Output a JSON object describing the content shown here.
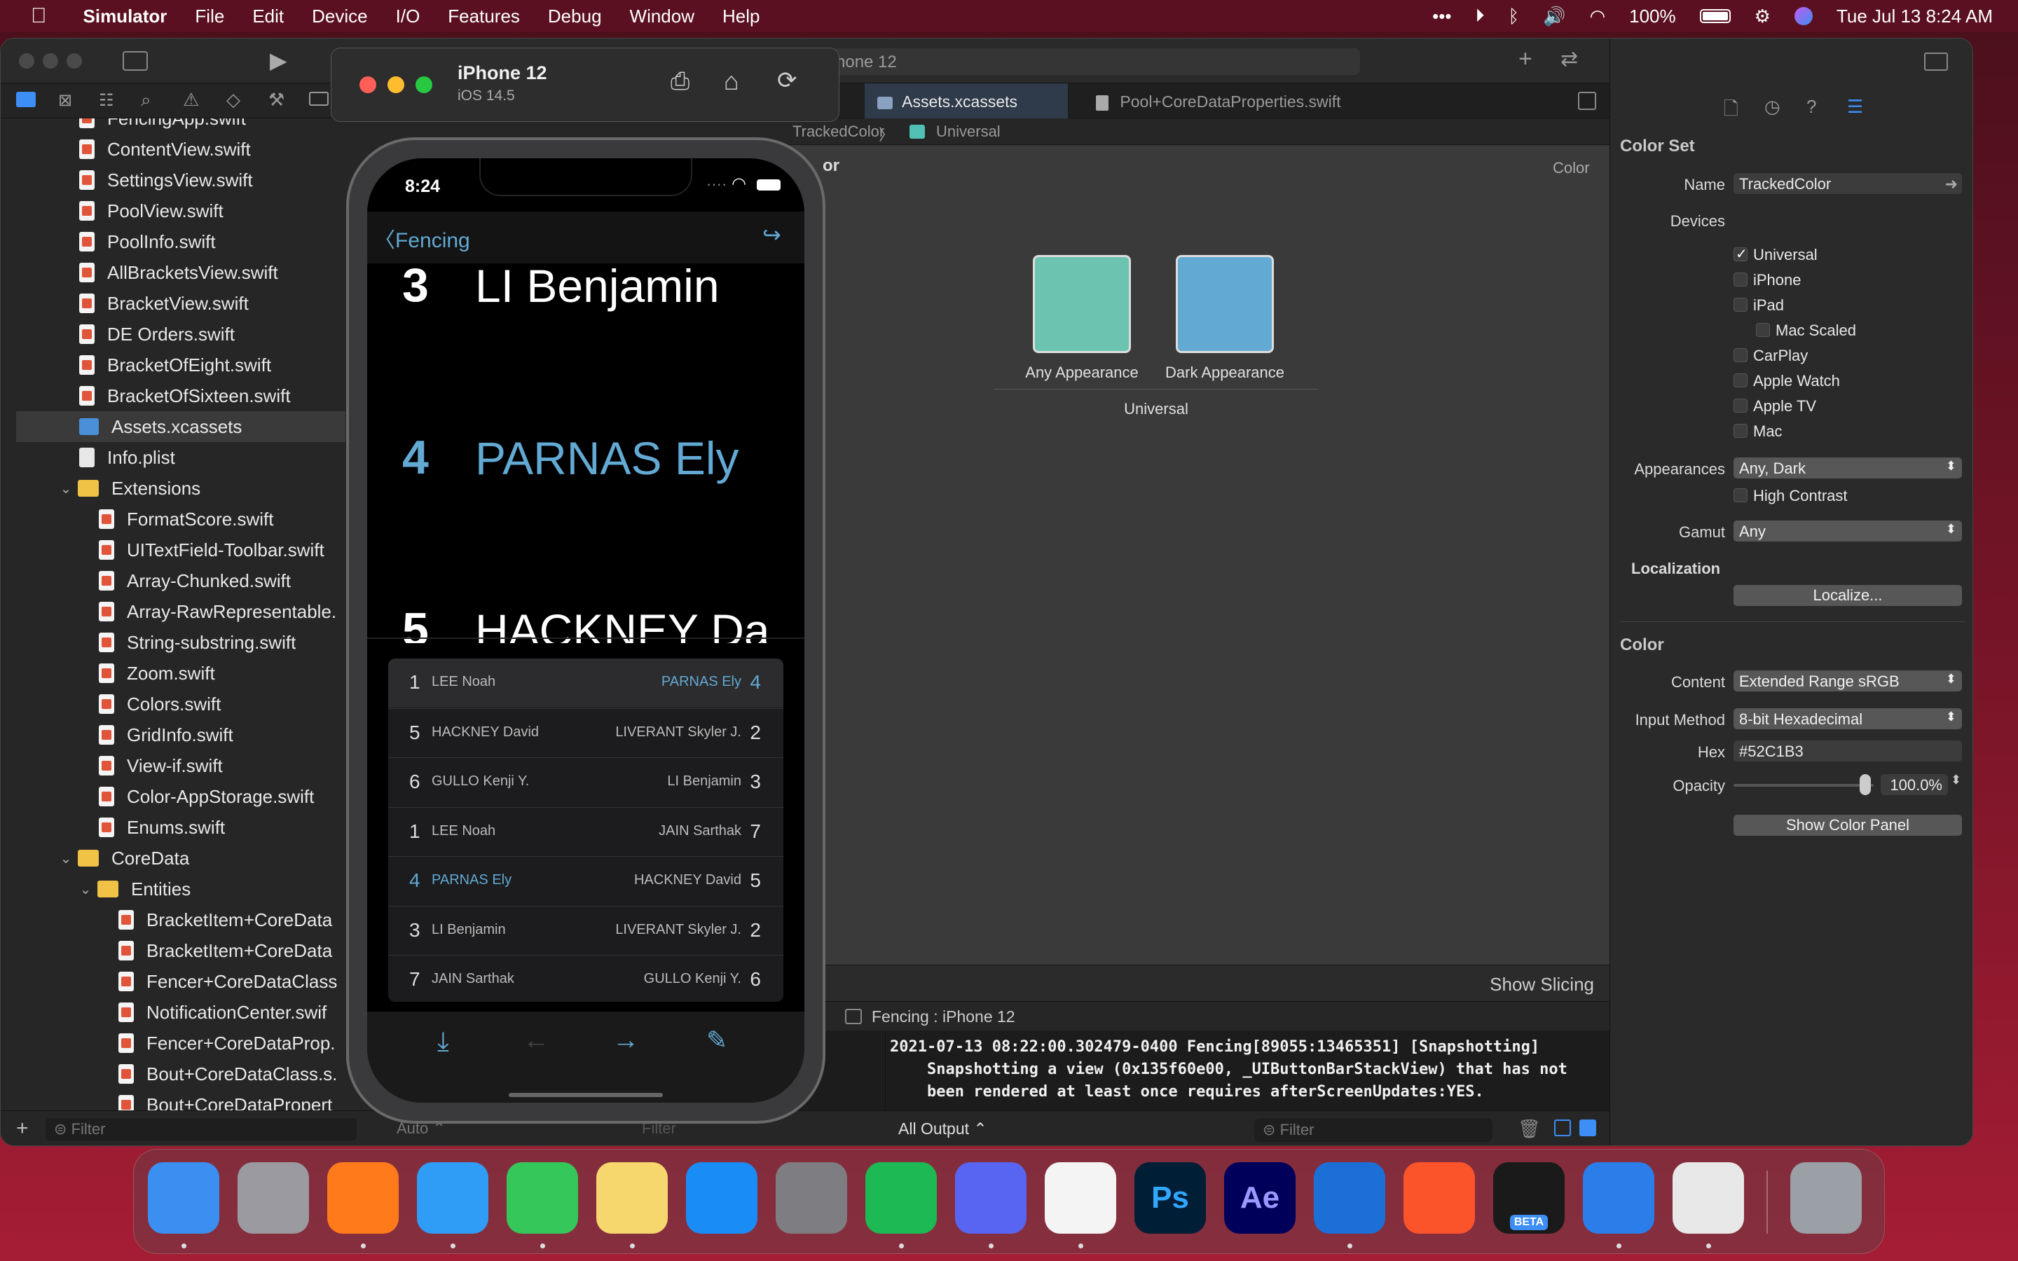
{
  "menubar": {
    "app": "Simulator",
    "items": [
      "File",
      "Edit",
      "Device",
      "I/O",
      "Features",
      "Debug",
      "Window",
      "Help"
    ],
    "battery": "100%",
    "datetime": "Tue Jul 13  8:24 AM"
  },
  "xcode": {
    "scheme_partial": "hone 12",
    "tabs": [
      "Assets.xcassets",
      "Pool+CoreDataProperties.swift"
    ],
    "jumpbar": [
      "TrackedColor",
      "Universal"
    ],
    "navigator_filter_placeholder": "Filter",
    "files": [
      {
        "name": "FencingApp.swift",
        "type": "swift",
        "indent": 0
      },
      {
        "name": "ContentView.swift",
        "type": "swift",
        "indent": 0
      },
      {
        "name": "SettingsView.swift",
        "type": "swift",
        "indent": 0
      },
      {
        "name": "PoolView.swift",
        "type": "swift",
        "indent": 0
      },
      {
        "name": "PoolInfo.swift",
        "type": "swift",
        "indent": 0
      },
      {
        "name": "AllBracketsView.swift",
        "type": "swift",
        "indent": 0
      },
      {
        "name": "BracketView.swift",
        "type": "swift",
        "indent": 0
      },
      {
        "name": "DE Orders.swift",
        "type": "swift",
        "indent": 0
      },
      {
        "name": "BracketOfEight.swift",
        "type": "swift",
        "indent": 0
      },
      {
        "name": "BracketOfSixteen.swift",
        "type": "swift",
        "indent": 0
      },
      {
        "name": "Assets.xcassets",
        "type": "assets",
        "indent": 0,
        "selected": true
      },
      {
        "name": "Info.plist",
        "type": "plist",
        "indent": 0
      },
      {
        "name": "Extensions",
        "type": "folder",
        "indent": 0,
        "open": true
      },
      {
        "name": "FormatScore.swift",
        "type": "swift",
        "indent": 1
      },
      {
        "name": "UITextField-Toolbar.swift",
        "type": "swift",
        "indent": 1
      },
      {
        "name": "Array-Chunked.swift",
        "type": "swift",
        "indent": 1
      },
      {
        "name": "Array-RawRepresentable.",
        "type": "swift",
        "indent": 1
      },
      {
        "name": "String-substring.swift",
        "type": "swift",
        "indent": 1
      },
      {
        "name": "Zoom.swift",
        "type": "swift",
        "indent": 1
      },
      {
        "name": "Colors.swift",
        "type": "swift",
        "indent": 1
      },
      {
        "name": "GridInfo.swift",
        "type": "swift",
        "indent": 1
      },
      {
        "name": "View-if.swift",
        "type": "swift",
        "indent": 1
      },
      {
        "name": "Color-AppStorage.swift",
        "type": "swift",
        "indent": 1
      },
      {
        "name": "Enums.swift",
        "type": "swift",
        "indent": 1
      },
      {
        "name": "CoreData",
        "type": "folder",
        "indent": 0,
        "open": true
      },
      {
        "name": "Entities",
        "type": "folder",
        "indent": 1,
        "open": true
      },
      {
        "name": "BracketItem+CoreData",
        "type": "swift",
        "indent": 2
      },
      {
        "name": "BracketItem+CoreData",
        "type": "swift",
        "indent": 2
      },
      {
        "name": "Fencer+CoreDataClass",
        "type": "swift",
        "indent": 2
      },
      {
        "name": "NotificationCenter.swif",
        "type": "swift",
        "indent": 2
      },
      {
        "name": "Fencer+CoreDataProp.",
        "type": "swift",
        "indent": 2
      },
      {
        "name": "Bout+CoreDataClass.s.",
        "type": "swift",
        "indent": 2
      },
      {
        "name": "Bout+CoreDataPropert",
        "type": "swift",
        "indent": 2
      }
    ],
    "canvas": {
      "header_partial": "or",
      "color_label": "Color",
      "swatches": [
        {
          "label": "Any Appearance",
          "color": "#6cc3b0"
        },
        {
          "label": "Dark Appearance",
          "color": "#62a9d3"
        }
      ],
      "group_label": "Universal",
      "show_slicing": "Show Slicing"
    },
    "debug": {
      "target": "Fencing : iPhone 12",
      "console_text": "2021-07-13 08:22:00.302479-0400 Fencing[89055:13465351] [Snapshotting]\n    Snapshotting a view (0x135f60e00, _UIButtonBarStackView) that has not\n    been rendered at least once requires afterScreenUpdates:YES.",
      "output_selector": "All Output ⌃",
      "filter_placeholder": "Filter",
      "vars_mode": "Auto ⌃",
      "vars_filter": "Filter"
    }
  },
  "inspector": {
    "section_colorset": "Color Set",
    "name_label": "Name",
    "name_value": "TrackedColor",
    "devices_label": "Devices",
    "devices": [
      {
        "label": "Universal",
        "checked": true,
        "indent": 0
      },
      {
        "label": "iPhone",
        "checked": false,
        "indent": 0
      },
      {
        "label": "iPad",
        "checked": false,
        "indent": 0
      },
      {
        "label": "Mac Scaled",
        "checked": false,
        "indent": 1
      },
      {
        "label": "CarPlay",
        "checked": false,
        "indent": 0
      },
      {
        "label": "Apple Watch",
        "checked": false,
        "indent": 0
      },
      {
        "label": "Apple TV",
        "checked": false,
        "indent": 0
      },
      {
        "label": "Mac",
        "checked": false,
        "indent": 0
      }
    ],
    "appearances_label": "Appearances",
    "appearances_value": "Any, Dark",
    "high_contrast": "High Contrast",
    "gamut_label": "Gamut",
    "gamut_value": "Any",
    "localization_label": "Localization",
    "localize_button": "Localize...",
    "section_color": "Color",
    "content_label": "Content",
    "content_value": "Extended Range sRGB",
    "input_label": "Input Method",
    "input_value": "8-bit Hexadecimal",
    "hex_label": "Hex",
    "hex_value": "#52C1B3",
    "opacity_label": "Opacity",
    "opacity_value": "100.0%",
    "show_color_panel": "Show Color Panel"
  },
  "simulator": {
    "device": "iPhone 12",
    "os": "iOS 14.5"
  },
  "iphone": {
    "time": "8:24",
    "back_label": "Fencing",
    "accent": "#62a9d3",
    "big_list": [
      {
        "seed": "3",
        "name": "LI Benjamin",
        "highlight": false
      },
      {
        "seed": "4",
        "name": "PARNAS Ely",
        "highlight": true
      },
      {
        "seed": "5",
        "name": "HACKNEY Da",
        "highlight": false
      }
    ],
    "bouts": [
      {
        "l_seed": "1",
        "l_name": "LEE Noah",
        "r_name": "PARNAS Ely",
        "r_seed": "4",
        "l_hl": false,
        "r_hl": true
      },
      {
        "l_seed": "5",
        "l_name": "HACKNEY David",
        "r_name": "LIVERANT Skyler J.",
        "r_seed": "2",
        "l_hl": false,
        "r_hl": false
      },
      {
        "l_seed": "6",
        "l_name": "GULLO Kenji Y.",
        "r_name": "LI Benjamin",
        "r_seed": "3",
        "l_hl": false,
        "r_hl": false
      },
      {
        "l_seed": "1",
        "l_name": "LEE Noah",
        "r_name": "JAIN Sarthak",
        "r_seed": "7",
        "l_hl": false,
        "r_hl": false
      },
      {
        "l_seed": "4",
        "l_name": "PARNAS Ely",
        "r_name": "HACKNEY David",
        "r_seed": "5",
        "l_hl": true,
        "r_hl": false
      },
      {
        "l_seed": "3",
        "l_name": "LI Benjamin",
        "r_name": "LIVERANT Skyler J.",
        "r_seed": "2",
        "l_hl": false,
        "r_hl": false
      },
      {
        "l_seed": "7",
        "l_name": "JAIN Sarthak",
        "r_name": "GULLO Kenji Y.",
        "r_seed": "6",
        "l_hl": false,
        "r_hl": false
      }
    ]
  },
  "dock": {
    "apps": [
      {
        "name": "finder",
        "label": "",
        "color": "#3b8ff0",
        "running": true
      },
      {
        "name": "launchpad",
        "label": "",
        "color": "#9a9aa0",
        "running": false
      },
      {
        "name": "firefox",
        "label": "",
        "color": "#ff7a1a",
        "running": true
      },
      {
        "name": "safari",
        "label": "",
        "color": "#2f9cf5",
        "running": true
      },
      {
        "name": "messages",
        "label": "",
        "color": "#35c759",
        "running": true
      },
      {
        "name": "notes",
        "label": "",
        "color": "#f5d76e",
        "running": true
      },
      {
        "name": "app-store",
        "label": "",
        "color": "#1a8cf5",
        "running": false
      },
      {
        "name": "system-preferences",
        "label": "",
        "color": "#7d7d82",
        "running": false
      },
      {
        "name": "spotify",
        "label": "",
        "color": "#1db954",
        "running": true
      },
      {
        "name": "discord",
        "label": "",
        "color": "#5865f2",
        "running": true
      },
      {
        "name": "vscode",
        "label": "",
        "color": "#f4f4f4",
        "running": true
      },
      {
        "name": "photoshop",
        "label": "Ps",
        "color": "#001e36",
        "running": false
      },
      {
        "name": "after-effects",
        "label": "Ae",
        "color": "#00005b",
        "running": false
      },
      {
        "name": "xcode",
        "label": "",
        "color": "#1c6fd6",
        "running": true
      },
      {
        "name": "brave",
        "label": "",
        "color": "#fb542b",
        "running": false
      },
      {
        "name": "testflight-beta",
        "label": "BETA",
        "color": "#1a1a1a",
        "running": false
      },
      {
        "name": "simulator",
        "label": "",
        "color": "#2b7de9",
        "running": true
      },
      {
        "name": "preview",
        "label": "",
        "color": "#e8e8e8",
        "running": true
      },
      {
        "name": "trash",
        "label": "",
        "color": "#9aa0a6",
        "running": false
      }
    ]
  }
}
